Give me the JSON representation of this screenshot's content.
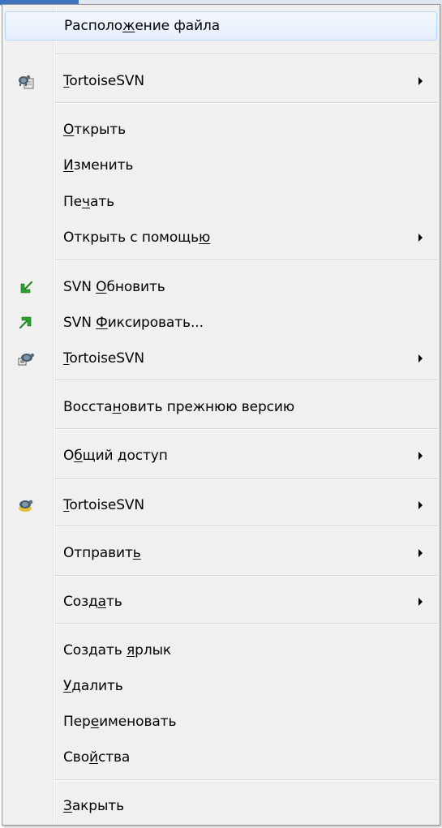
{
  "menu": {
    "items": [
      {
        "id": "open-file-location",
        "pre": "Располо",
        "u": "ж",
        "post": "ение файла",
        "submenu": false,
        "highlighted": true,
        "icon": null
      },
      {
        "id": "tortoisesvn-1",
        "pre": "",
        "u": "T",
        "post": "ortoiseSVN",
        "submenu": true,
        "highlighted": false,
        "icon": "tortoisesvn-folder-icon"
      },
      {
        "id": "open",
        "pre": "",
        "u": "О",
        "post": "ткрыть",
        "submenu": false,
        "highlighted": false,
        "icon": null
      },
      {
        "id": "edit",
        "pre": "",
        "u": "И",
        "post": "зменить",
        "submenu": false,
        "highlighted": false,
        "icon": null
      },
      {
        "id": "print",
        "pre": "Пе",
        "u": "ч",
        "post": "ать",
        "submenu": false,
        "highlighted": false,
        "icon": null
      },
      {
        "id": "open-with",
        "pre": "Открыть с помощь",
        "u": "ю",
        "post": "",
        "submenu": true,
        "highlighted": false,
        "icon": null
      },
      {
        "id": "svn-update",
        "pre": "SVN ",
        "u": "О",
        "post": "бновить",
        "submenu": false,
        "highlighted": false,
        "icon": "svn-update-arrow-icon"
      },
      {
        "id": "svn-commit",
        "pre": "SVN ",
        "u": "Ф",
        "post": "иксировать...",
        "submenu": false,
        "highlighted": false,
        "icon": "svn-commit-arrow-icon"
      },
      {
        "id": "tortoisesvn-2",
        "pre": "",
        "u": "T",
        "post": "ortoiseSVN",
        "submenu": true,
        "highlighted": false,
        "icon": "tortoisesvn-turtle-icon"
      },
      {
        "id": "restore-previous",
        "pre": "Восста",
        "u": "н",
        "post": "овить прежнюю версию",
        "submenu": false,
        "highlighted": false,
        "icon": null
      },
      {
        "id": "share",
        "pre": "О",
        "u": "б",
        "post": "щий доступ",
        "submenu": true,
        "highlighted": false,
        "icon": null
      },
      {
        "id": "tortoisesvn-3",
        "pre": "",
        "u": "T",
        "post": "ortoiseSVN",
        "submenu": true,
        "highlighted": false,
        "icon": "tortoisesvn-turtle-yellow-icon"
      },
      {
        "id": "send-to",
        "pre": "Отправит",
        "u": "ь",
        "post": "",
        "submenu": true,
        "highlighted": false,
        "icon": null
      },
      {
        "id": "new",
        "pre": "Созд",
        "u": "а",
        "post": "ть",
        "submenu": true,
        "highlighted": false,
        "icon": null
      },
      {
        "id": "create-shortcut",
        "pre": "Создать ",
        "u": "я",
        "post": "рлык",
        "submenu": false,
        "highlighted": false,
        "icon": null
      },
      {
        "id": "delete",
        "pre": "",
        "u": "У",
        "post": "далить",
        "submenu": false,
        "highlighted": false,
        "icon": null
      },
      {
        "id": "rename",
        "pre": "Пер",
        "u": "е",
        "post": "именовать",
        "submenu": false,
        "highlighted": false,
        "icon": null
      },
      {
        "id": "properties",
        "pre": "Сво",
        "u": "й",
        "post": "ства",
        "submenu": false,
        "highlighted": false,
        "icon": null
      },
      {
        "id": "close",
        "pre": "",
        "u": "З",
        "post": "акрыть",
        "submenu": false,
        "highlighted": false,
        "icon": null
      }
    ]
  },
  "colors": {
    "menu_bg": "#f0f0f0",
    "highlight_border": "#b8d6fb",
    "svn_green": "#2aa12a",
    "text": "#000000"
  }
}
